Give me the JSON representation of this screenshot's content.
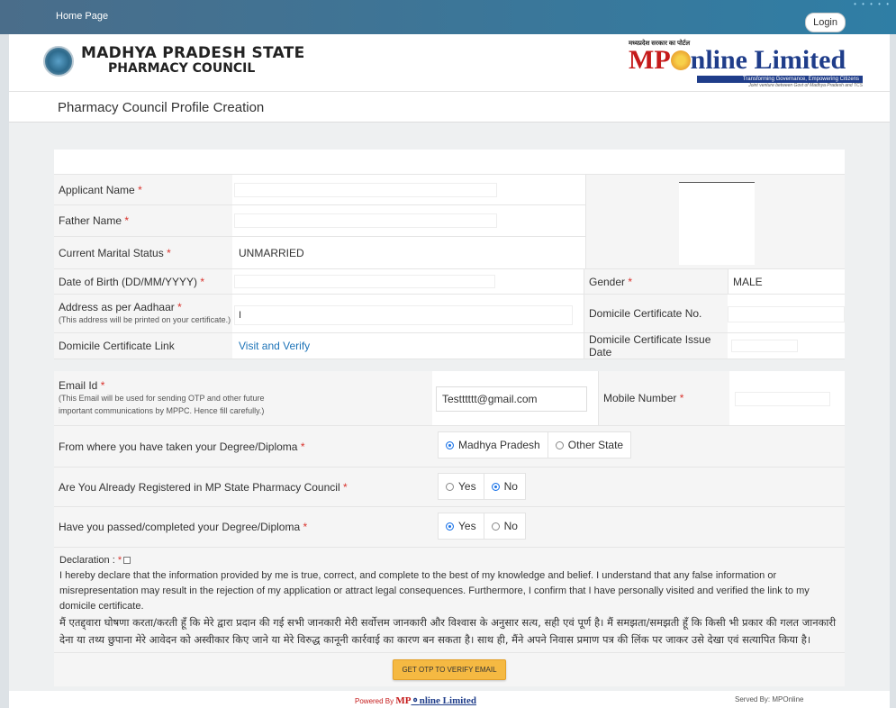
{
  "topbar": {
    "home": "Home Page",
    "login": "Login"
  },
  "header": {
    "org_line1": "MADHYA PRADESH STATE",
    "org_line2": "PHARMACY COUNCIL",
    "partner_hindi": "मध्यप्रदेश सरकार का पोर्टल",
    "partner_brand_pre": "MP",
    "partner_brand_post": "nline Limited",
    "partner_tagline": "Transforming Governance, Empowering Citizens",
    "partner_sub": "Joint venture between Govt of Madhya Pradesh and TCS"
  },
  "page_title": "Pharmacy Council Profile Creation",
  "form": {
    "applicant_name_label": "Applicant Name",
    "father_name_label": "Father Name",
    "marital_label": "Current Marital Status",
    "marital_value": "UNMARRIED",
    "dob_label": "Date of Birth (DD/MM/YYYY)",
    "gender_label": "Gender",
    "gender_value": "MALE",
    "address_label": "Address as per Aadhaar",
    "address_note": "(This address will be printed on your certificate.)",
    "address_value": "I",
    "domicile_no_label": "Domicile Certificate No.",
    "domicile_link_label": "Domicile Certificate Link",
    "domicile_link_text": "Visit and Verify",
    "domicile_date_label": "Domicile Certificate Issue Date",
    "email_label": "Email Id",
    "email_note_1": "(This Email will be used for sending OTP and other future",
    "email_note_2": "important communications by MPPC. Hence fill carefully.)",
    "email_value": "Testttttt@gmail.com",
    "mobile_label": "Mobile Number",
    "degree_from_label": "From where you have taken your Degree/Diploma",
    "degree_from_opt1": "Madhya Pradesh",
    "degree_from_opt2": "Other State",
    "registered_label": "Are You Already Registered in MP State Pharmacy Council",
    "passed_label": "Have you passed/completed your Degree/Diploma",
    "yes": "Yes",
    "no": "No",
    "required_mark": "*"
  },
  "declaration": {
    "label": "Declaration :",
    "english": "I hereby declare that the information provided by me is true, correct, and complete to the best of my knowledge and belief. I understand that any false information or misrepresentation may result in the rejection of my application or attract legal consequences. Furthermore, I confirm that I have personally visited and verified the link to my domicile certificate.",
    "hindi": "मैं एतद्द्वारा घोषणा करता/करती हूँ कि मेरे द्वारा प्रदान की गई सभी जानकारी मेरी सर्वोत्तम जानकारी और विश्वास के अनुसार सत्य, सही एवं पूर्ण है। मैं समझता/समझती हूँ कि किसी भी प्रकार की गलत जानकारी देना या तथ्य छुपाना मेरे आवेदन को अस्वीकार किए जाने या मेरे विरुद्ध कानूनी कार्रवाई का कारण बन सकता है। साथ ही, मैंने अपने निवास प्रमाण पत्र की लिंक पर जाकर उसे देखा एवं सत्यापित किया है।"
  },
  "otp_button": "GET OTP TO VERIFY EMAIL",
  "footer": {
    "powered_by": "Powered By",
    "brand_pre": "MP",
    "brand_post": "nline Limited",
    "served_by": "Served By: MPOnline"
  },
  "colors": {
    "required": "#d9332d",
    "link": "#1e74b8",
    "button": "#f5b942",
    "topbar": "#2f7ea5"
  }
}
